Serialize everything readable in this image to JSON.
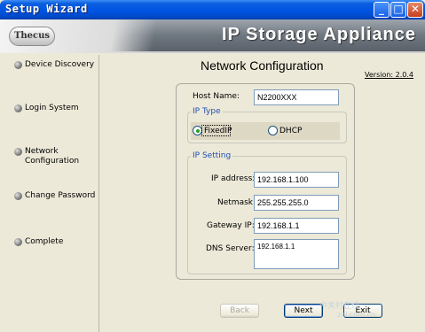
{
  "window": {
    "title": "Setup Wizard",
    "minimize_glyph": "_",
    "maximize_glyph": "□",
    "close_glyph": "✕"
  },
  "banner": {
    "logo_text": "Thecus",
    "product": "IP Storage Appliance"
  },
  "sidebar": {
    "items": [
      {
        "label": "Device Discovery",
        "icon": "bullet-icon"
      },
      {
        "label": "Login System",
        "icon": "bullet-icon"
      },
      {
        "label": "Network Configuration",
        "icon": "bullet-icon"
      },
      {
        "label": "Change Password",
        "icon": "bullet-icon"
      },
      {
        "label": "Complete",
        "icon": "bullet-icon"
      }
    ]
  },
  "main": {
    "heading": "Network Configuration",
    "version": "Version: 2.0.4",
    "host_name": {
      "label": "Host Name:",
      "value": "N2200XXX"
    },
    "ip_type": {
      "title": "IP Type",
      "options": [
        "FixedIP",
        "DHCP"
      ],
      "selected": "FixedIP"
    },
    "ip_setting": {
      "title": "IP Setting",
      "ip_address": {
        "label": "IP address:",
        "value": "192.168.1.100"
      },
      "netmask": {
        "label": "Netmask:",
        "value": "255.255.255.0"
      },
      "gateway": {
        "label": "Gateway IP:",
        "value": "192.168.1.1"
      },
      "dns": {
        "label": "DNS Server:",
        "value": "192.168.1.1"
      }
    }
  },
  "buttons": {
    "back": "Back",
    "next": "Next",
    "exit": "Exit"
  },
  "watermark": {
    "line1": "中关村在线",
    "line2": "zol.com.cn"
  },
  "colors": {
    "titlebar": "#0054e3",
    "group_title": "#1f4fb5",
    "radio_dot": "#21a121"
  }
}
